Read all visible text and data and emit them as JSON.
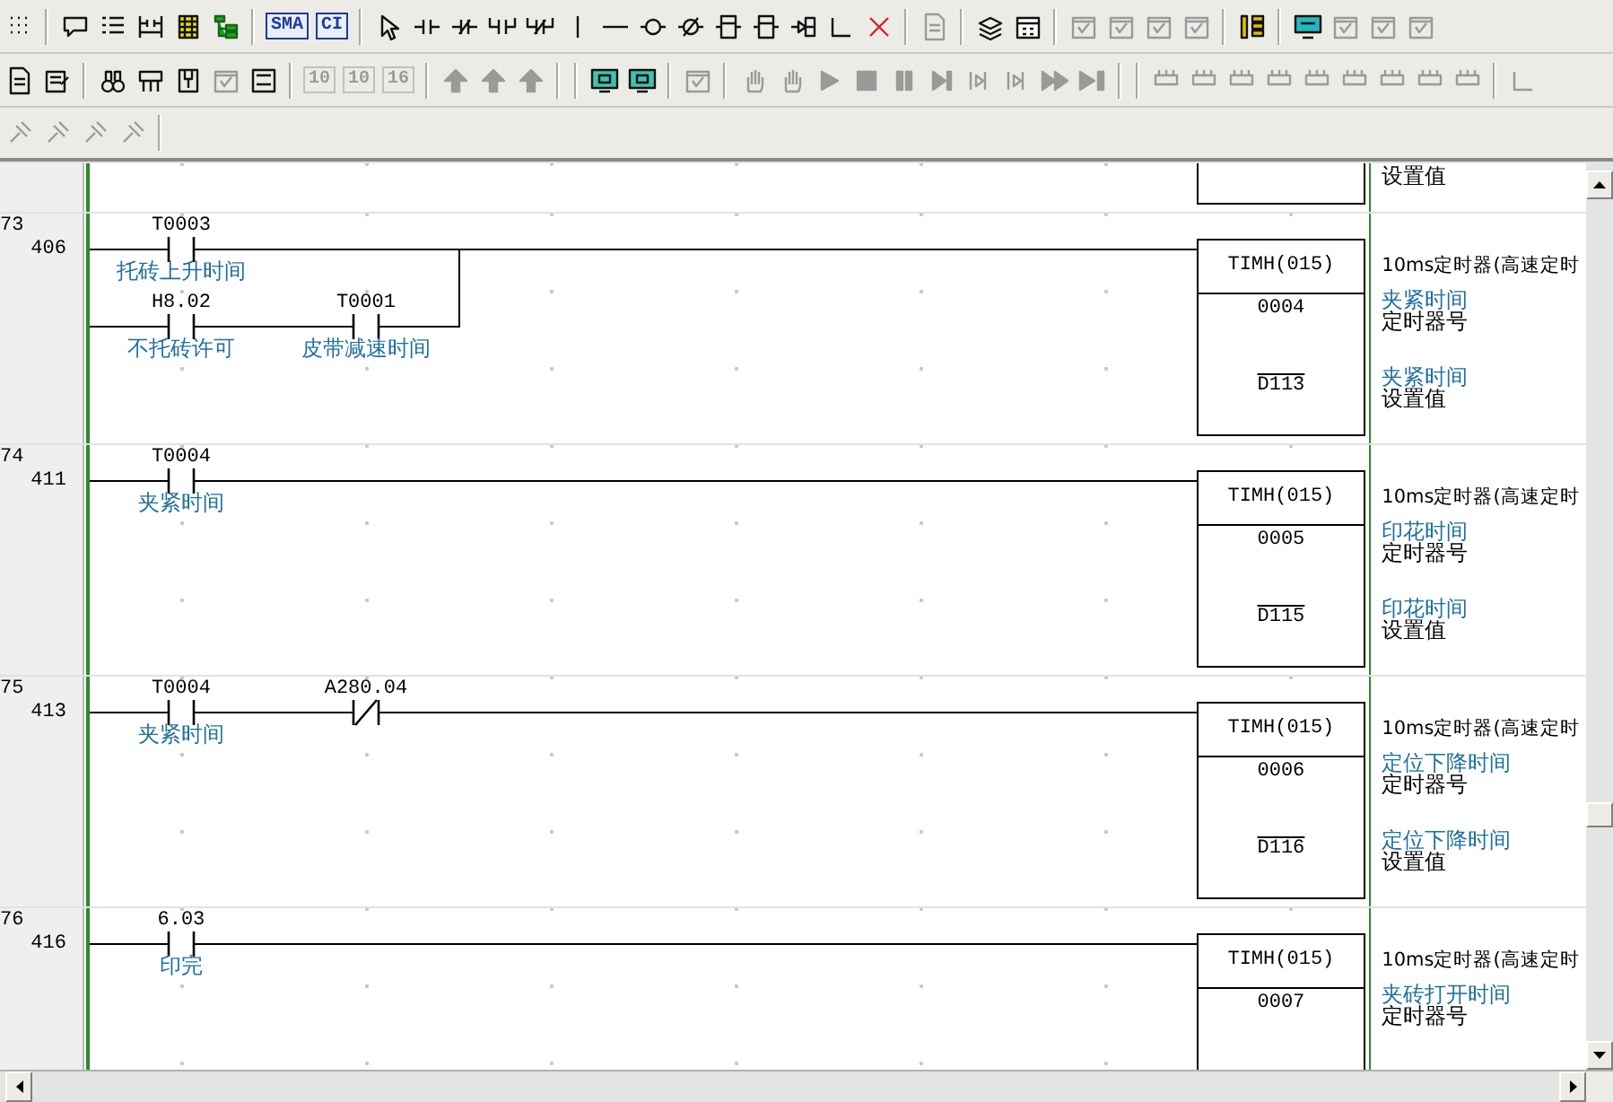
{
  "toolbars": [
    {
      "items": [
        {
          "kind": "icon",
          "disabled": false
        },
        {
          "kind": "separator"
        },
        {
          "kind": "icon",
          "disabled": false
        },
        {
          "kind": "icon",
          "disabled": false
        },
        {
          "kind": "icon",
          "disabled": false
        },
        {
          "kind": "icon",
          "disabled": false
        },
        {
          "kind": "icon",
          "disabled": false
        },
        {
          "kind": "separator"
        },
        {
          "kind": "text",
          "label": "SMA",
          "disabled": false
        },
        {
          "kind": "text",
          "label": "CI",
          "disabled": false
        },
        {
          "kind": "separator"
        },
        {
          "kind": "icon",
          "disabled": false
        },
        {
          "kind": "icon",
          "disabled": false
        },
        {
          "kind": "icon",
          "disabled": false
        },
        {
          "kind": "icon",
          "disabled": false
        },
        {
          "kind": "icon",
          "disabled": false
        },
        {
          "kind": "icon",
          "disabled": false
        },
        {
          "kind": "icon",
          "disabled": false
        },
        {
          "kind": "icon",
          "disabled": false
        },
        {
          "kind": "icon",
          "disabled": false
        },
        {
          "kind": "icon",
          "disabled": false
        },
        {
          "kind": "icon",
          "disabled": false
        },
        {
          "kind": "icon",
          "disabled": false
        },
        {
          "kind": "icon",
          "disabled": false
        },
        {
          "kind": "icon",
          "disabled": false
        },
        {
          "kind": "separator"
        },
        {
          "kind": "icon",
          "disabled": true
        },
        {
          "kind": "separator"
        },
        {
          "kind": "icon",
          "disabled": false
        },
        {
          "kind": "icon",
          "disabled": false
        },
        {
          "kind": "separator"
        },
        {
          "kind": "icon",
          "disabled": true
        },
        {
          "kind": "icon",
          "disabled": true
        },
        {
          "kind": "icon",
          "disabled": true
        },
        {
          "kind": "icon",
          "disabled": true
        },
        {
          "kind": "separator"
        },
        {
          "kind": "icon",
          "disabled": false
        },
        {
          "kind": "separator"
        },
        {
          "kind": "icon",
          "disabled": false
        },
        {
          "kind": "icon",
          "disabled": true
        },
        {
          "kind": "icon",
          "disabled": true
        },
        {
          "kind": "icon",
          "disabled": true
        }
      ]
    },
    {
      "items": [
        {
          "kind": "icon",
          "disabled": false
        },
        {
          "kind": "icon",
          "disabled": false
        },
        {
          "kind": "separator"
        },
        {
          "kind": "icon",
          "disabled": false
        },
        {
          "kind": "icon",
          "disabled": false
        },
        {
          "kind": "icon",
          "disabled": false
        },
        {
          "kind": "icon",
          "disabled": true
        },
        {
          "kind": "icon",
          "disabled": false
        },
        {
          "kind": "separator"
        },
        {
          "kind": "text",
          "label": "10",
          "disabled": true
        },
        {
          "kind": "text",
          "label": "10",
          "disabled": true
        },
        {
          "kind": "text",
          "label": "16",
          "disabled": true
        },
        {
          "kind": "separator"
        },
        {
          "kind": "icon",
          "disabled": true
        },
        {
          "kind": "icon",
          "disabled": true
        },
        {
          "kind": "icon",
          "disabled": true
        },
        {
          "kind": "separator"
        },
        {
          "kind": "separator"
        },
        {
          "kind": "icon",
          "disabled": false
        },
        {
          "kind": "icon",
          "disabled": false
        },
        {
          "kind": "separator"
        },
        {
          "kind": "icon",
          "disabled": true
        },
        {
          "kind": "separator"
        },
        {
          "kind": "icon",
          "disabled": true
        },
        {
          "kind": "icon",
          "disabled": true
        },
        {
          "kind": "icon",
          "disabled": true
        },
        {
          "kind": "icon",
          "disabled": true
        },
        {
          "kind": "icon",
          "disabled": true
        },
        {
          "kind": "icon",
          "disabled": true
        },
        {
          "kind": "icon",
          "disabled": true
        },
        {
          "kind": "icon",
          "disabled": true
        },
        {
          "kind": "icon",
          "disabled": true
        },
        {
          "kind": "icon",
          "disabled": true
        },
        {
          "kind": "separator"
        },
        {
          "kind": "separator"
        },
        {
          "kind": "icon",
          "disabled": true
        },
        {
          "kind": "icon",
          "disabled": true
        },
        {
          "kind": "icon",
          "disabled": true
        },
        {
          "kind": "icon",
          "disabled": true
        },
        {
          "kind": "icon",
          "disabled": true
        },
        {
          "kind": "icon",
          "disabled": true
        },
        {
          "kind": "icon",
          "disabled": true
        },
        {
          "kind": "icon",
          "disabled": true
        },
        {
          "kind": "icon",
          "disabled": true
        },
        {
          "kind": "separator"
        },
        {
          "kind": "icon",
          "disabled": true
        }
      ]
    },
    {
      "items": [
        {
          "kind": "icon",
          "disabled": true
        },
        {
          "kind": "icon",
          "disabled": true
        },
        {
          "kind": "icon",
          "disabled": true
        },
        {
          "kind": "icon",
          "disabled": true
        },
        {
          "kind": "separator"
        }
      ]
    }
  ],
  "ladder": {
    "top_partial": {
      "operand_description": "设置值"
    },
    "rungs": [
      {
        "number": "73",
        "step": "406",
        "cut_off": false,
        "rows": [
          {
            "contacts": [
              {
                "kind": "no",
                "address": "T0003",
                "comment": "托砖上升时间"
              }
            ]
          },
          {
            "contacts": [
              {
                "kind": "no",
                "address": "H8.02",
                "comment": "不托砖许可"
              },
              {
                "kind": "no",
                "address": "T0001",
                "comment": "皮带减速时间"
              }
            ]
          }
        ],
        "instruction": {
          "mnemonic": "TIMH(015)",
          "comment": "10ms定时器(高速定时",
          "operands": [
            {
              "value": "0004",
              "overline": false,
              "comment": "夹紧时间",
              "description": "定时器号"
            },
            {
              "value": "D113",
              "overline": true,
              "comment": "夹紧时间",
              "description": "设置值"
            }
          ]
        }
      },
      {
        "number": "74",
        "step": "411",
        "cut_off": false,
        "rows": [
          {
            "contacts": [
              {
                "kind": "no",
                "address": "T0004",
                "comment": "夹紧时间"
              }
            ]
          }
        ],
        "instruction": {
          "mnemonic": "TIMH(015)",
          "comment": "10ms定时器(高速定时",
          "operands": [
            {
              "value": "0005",
              "overline": false,
              "comment": "印花时间",
              "description": "定时器号"
            },
            {
              "value": "D115",
              "overline": true,
              "comment": "印花时间",
              "description": "设置值"
            }
          ]
        }
      },
      {
        "number": "75",
        "step": "413",
        "cut_off": false,
        "rows": [
          {
            "contacts": [
              {
                "kind": "no",
                "address": "T0004",
                "comment": "夹紧时间"
              },
              {
                "kind": "nc",
                "address": "A280.04"
              }
            ]
          }
        ],
        "instruction": {
          "mnemonic": "TIMH(015)",
          "comment": "10ms定时器(高速定时",
          "operands": [
            {
              "value": "0006",
              "overline": false,
              "comment": "定位下降时间",
              "description": "定时器号"
            },
            {
              "value": "D116",
              "overline": true,
              "comment": "定位下降时间",
              "description": "设置值"
            }
          ]
        }
      },
      {
        "number": "76",
        "step": "416",
        "cut_off": true,
        "rows": [
          {
            "contacts": [
              {
                "kind": "no",
                "address": "6.03",
                "comment": "印完"
              }
            ]
          }
        ],
        "instruction": {
          "mnemonic": "TIMH(015)",
          "comment": "10ms定时器(高速定时",
          "operands": [
            {
              "value": "0007",
              "overline": false,
              "comment": "夹砖打开时间",
              "description": "定时器号"
            }
          ]
        }
      }
    ]
  }
}
